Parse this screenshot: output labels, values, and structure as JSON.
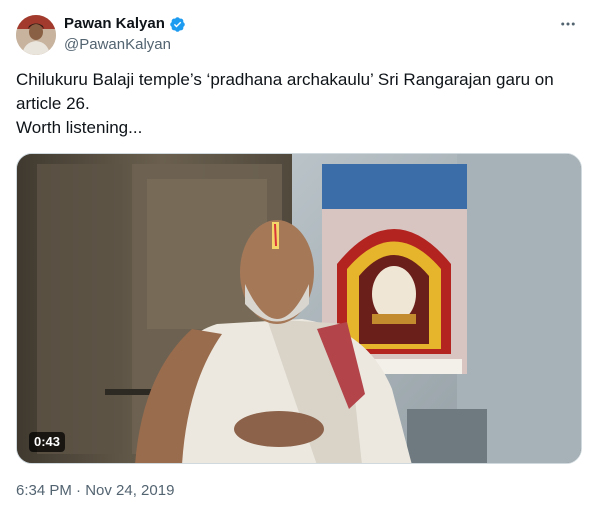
{
  "author": {
    "display_name": "Pawan Kalyan",
    "handle": "@PawanKalyan",
    "verified_icon": "verified-badge-icon",
    "accent": "#1d9bf0"
  },
  "tweet": {
    "text": "Chilukuru Balaji temple’s  ‘pradhana archakaulu’ Sri Rangarajan garu on article 26.\nWorth listening...",
    "timestamp": "6:34 PM · Nov 24, 2019"
  },
  "media": {
    "type": "video",
    "duration": "0:43"
  },
  "icons": {
    "more": "more-horizontal-icon"
  }
}
